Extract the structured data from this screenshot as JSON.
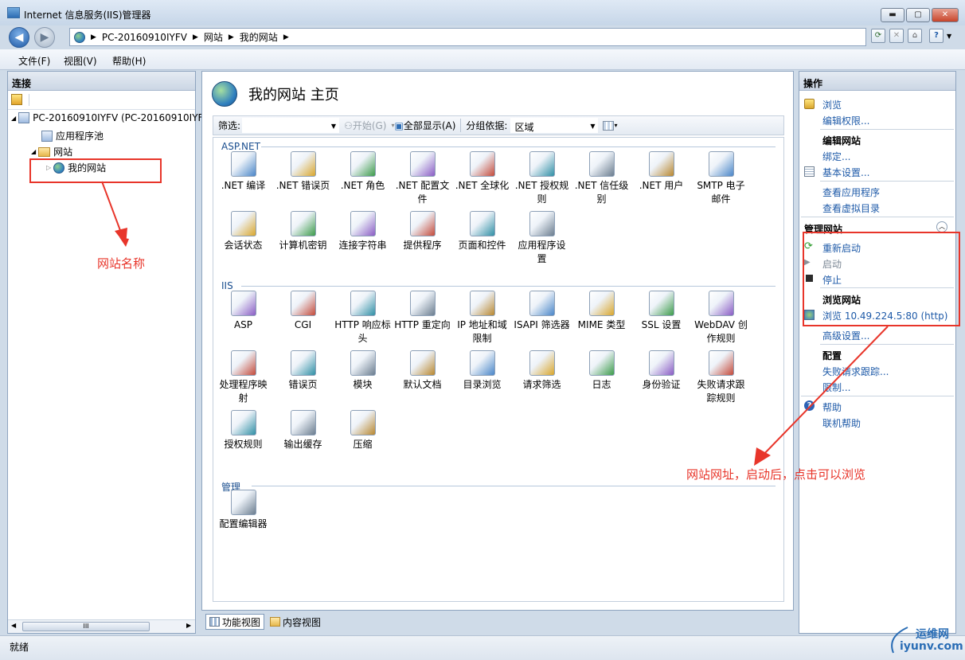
{
  "window": {
    "title": "Internet 信息服务(IIS)管理器",
    "min": "▬",
    "max": "▢",
    "close": "✕"
  },
  "address": {
    "crumbs": [
      "PC-20160910IYFV",
      "网站",
      "我的网站"
    ],
    "help": "?"
  },
  "menu": [
    "文件(F)",
    "视图(V)",
    "帮助(H)"
  ],
  "left": {
    "header": "连接",
    "tree": {
      "server": "PC-20160910IYFV (PC-20160910IYFV",
      "apppools": "应用程序池",
      "sites": "网站",
      "mysite": "我的网站"
    },
    "scroll_label": "III"
  },
  "center": {
    "title": "我的网站 主页",
    "filter_label": "筛选:",
    "start_label": "开始(G)",
    "showall_label": "全部显示(A)",
    "group_label": "分组依据:",
    "group_value": "区域",
    "sections": [
      {
        "name": "ASP.NET",
        "items": [
          ".NET 编译",
          ".NET 错误页",
          ".NET 角色",
          ".NET 配置文\n件",
          ".NET 全球化",
          ".NET 授权规\n则",
          ".NET 信任级\n别",
          ".NET 用户",
          "SMTP 电子\n邮件",
          "会话状态",
          "计算机密钥",
          "连接字符串",
          "提供程序",
          "页面和控件",
          "应用程序设\n置"
        ]
      },
      {
        "name": "IIS",
        "items": [
          "ASP",
          "CGI",
          "HTTP 响应标\n头",
          "HTTP 重定向",
          "IP 地址和域\n限制",
          "ISAPI 筛选器",
          "MIME 类型",
          "SSL 设置",
          "WebDAV 创\n作规则",
          "处理程序映\n射",
          "错误页",
          "模块",
          "默认文档",
          "目录浏览",
          "请求筛选",
          "日志",
          "身份验证",
          "失败请求跟\n踪规则",
          "授权规则",
          "输出缓存",
          "压缩"
        ]
      },
      {
        "name": "管理",
        "items": [
          "配置编辑器"
        ]
      }
    ],
    "tabs": {
      "features": "功能视图",
      "content": "内容视图"
    }
  },
  "right": {
    "header": "操作",
    "browse": "浏览",
    "edit_perms": "编辑权限...",
    "edit_site": "编辑网站",
    "bindings": "绑定...",
    "basic_settings": "基本设置...",
    "view_apps": "查看应用程序",
    "view_vdirs": "查看虚拟目录",
    "manage_site": "管理网站",
    "restart": "重新启动",
    "start": "启动",
    "stop": "停止",
    "browse_site": "浏览网站",
    "browse_url": "浏览 10.49.224.5:80 (http)",
    "advanced": "高级设置...",
    "config": "配置",
    "failed_req": "失败请求跟踪...",
    "limits": "限制...",
    "help": "帮助",
    "online_help": "联机帮助"
  },
  "status": "就绪",
  "annotations": {
    "site_name": "网站名称",
    "site_url": "网站网址，启动后，点击可以浏览",
    "color": "#e8352a"
  },
  "watermark": {
    "line1": "运维网",
    "line2": "iyunv.com"
  }
}
